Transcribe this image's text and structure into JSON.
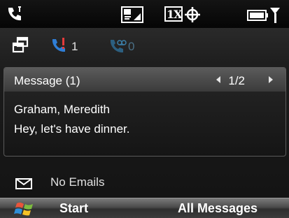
{
  "status_bar": {
    "icons": [
      "phone-call-icon",
      "sim-signal-icon",
      "1x-data-icon",
      "gps-icon",
      "battery-signal-icon"
    ],
    "data_label": "1X"
  },
  "home": {
    "toprow": {
      "icons": [
        "windows-icon",
        "missed-call-icon",
        "voicemail-icon"
      ],
      "missed_calls": "1",
      "voicemail_count": "0"
    },
    "message_panel": {
      "title": "Message (1)",
      "pager": "1/2",
      "sender": "Graham, Meredith",
      "preview": "Hey, let's have dinner."
    },
    "emails": {
      "icon": "envelope-icon",
      "label": "No Emails"
    }
  },
  "softkeys": {
    "left": "Start",
    "right": "All Messages",
    "logo": "windows-flag-icon"
  },
  "colors": {
    "background": "#0b0b0b",
    "header_gray": "#4a4a4a",
    "missed_call_red": "#e53b3b",
    "missed_call_blue": "#2f7ed6",
    "voicemail_blue": "#3b7fa8"
  }
}
